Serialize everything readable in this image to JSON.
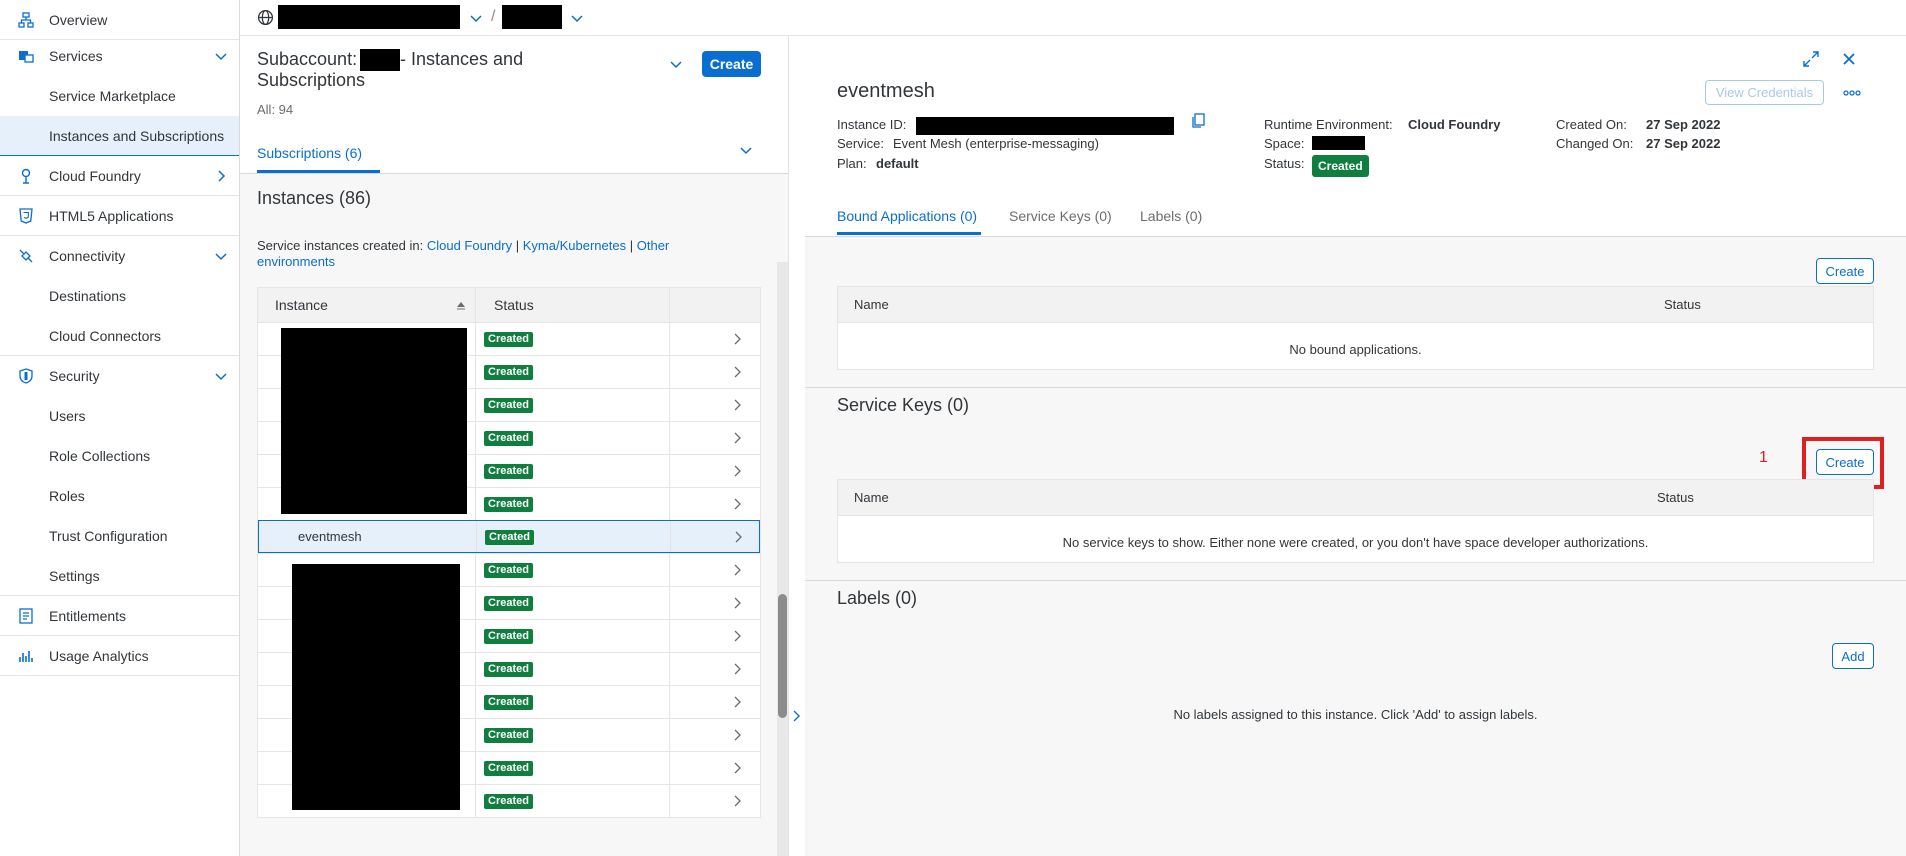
{
  "sidebar": {
    "items": [
      {
        "label": "Overview",
        "icon": "overview-icon"
      },
      {
        "label": "Services",
        "icon": "services-icon"
      },
      {
        "label": "Service Marketplace"
      },
      {
        "label": "Instances and Subscriptions"
      },
      {
        "label": "Cloud Foundry",
        "icon": "cloud-foundry-icon"
      },
      {
        "label": "HTML5 Applications",
        "icon": "html5-icon"
      },
      {
        "label": "Connectivity",
        "icon": "connectivity-icon"
      },
      {
        "label": "Destinations"
      },
      {
        "label": "Cloud Connectors"
      },
      {
        "label": "Security",
        "icon": "shield-icon"
      },
      {
        "label": "Users"
      },
      {
        "label": "Role Collections"
      },
      {
        "label": "Roles"
      },
      {
        "label": "Trust Configuration"
      },
      {
        "label": "Settings"
      },
      {
        "label": "Entitlements",
        "icon": "entitlements-icon"
      },
      {
        "label": "Usage Analytics",
        "icon": "usage-analytics-icon"
      }
    ]
  },
  "topbar": {
    "separator": "/"
  },
  "middle": {
    "title_prefix": "Subaccount:",
    "title_suffix": "- Instances and",
    "title_line2": "Subscriptions",
    "create_label": "Create",
    "count_label": "All: 94",
    "subscriptions_tab": "Subscriptions (6)",
    "instances_title": "Instances (86)",
    "created_in_text": "Service instances created in:",
    "link_cf": "Cloud Foundry",
    "link_kyma": "Kyma/Kubernetes",
    "link_other": "Other environments",
    "link_sep": "|",
    "col_instance": "Instance",
    "col_status": "Status",
    "selected_instance": "eventmesh",
    "status_text": "Created",
    "row_count": 15
  },
  "detail": {
    "title": "eventmesh",
    "view_credentials": "View Credentials",
    "instance_id_label": "Instance ID:",
    "service_label": "Service:",
    "service_value": "Event Mesh (enterprise-messaging)",
    "plan_label": "Plan:",
    "plan_value": "default",
    "runtime_label": "Runtime Environment:",
    "runtime_value": "Cloud Foundry",
    "space_label": "Space:",
    "status_label": "Status:",
    "status_value": "Created",
    "created_on_label": "Created On:",
    "created_on_value": "27 Sep 2022",
    "changed_on_label": "Changed On:",
    "changed_on_value": "27 Sep 2022",
    "tabs": [
      "Bound Applications (0)",
      "Service Keys (0)",
      "Labels (0)"
    ],
    "bound": {
      "create_label": "Create",
      "col_name": "Name",
      "col_status": "Status",
      "empty": "No bound applications."
    },
    "keys": {
      "title": "Service Keys (0)",
      "annotation": "1",
      "create_label": "Create",
      "col_name": "Name",
      "col_status": "Status",
      "empty": "No service keys to show. Either none were created, or you don't have space developer authorizations."
    },
    "labels": {
      "title": "Labels (0)",
      "add_label": "Add",
      "empty": "No labels assigned to this instance. Click 'Add' to assign labels."
    }
  },
  "colors": {
    "accent": "#0a6ed1",
    "success": "#107e3e",
    "highlight": "#e02020"
  }
}
